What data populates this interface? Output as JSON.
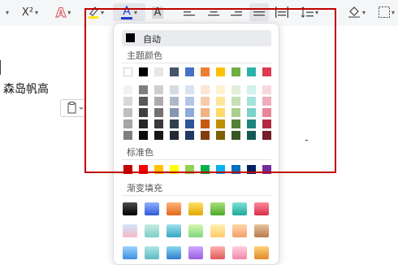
{
  "toolbar": {
    "superscript": "X²",
    "text_effect": "A",
    "font_color": "A",
    "char_shading": "A",
    "font_color_accent": "#1f3ccf",
    "highlight_accent": "#ffe600"
  },
  "document": {
    "text": "森岛帆高"
  },
  "color_panel": {
    "auto_label": "自动",
    "auto_color": "#000000",
    "theme_title": "主题颜色",
    "standard_title": "标准色",
    "gradient_title": "渐变填充",
    "theme_top": [
      "#ffffff",
      "#000000",
      "#e7e6e6",
      "#44546a",
      "#4472c4",
      "#ed7d31",
      "#ffc000",
      "#70ad47",
      "#2bb2a8",
      "#dd3b52"
    ],
    "theme_tints": [
      [
        "#f2f2f2",
        "#7f7f7f",
        "#d0cece",
        "#d6dce4",
        "#d9e2f3",
        "#fbe5d5",
        "#fff2cc",
        "#e2efd9",
        "#d2f0ec",
        "#f8d7dd"
      ],
      [
        "#d8d8d8",
        "#595959",
        "#aeabab",
        "#adb9ca",
        "#b4c6e7",
        "#f7caac",
        "#fee599",
        "#c5e0b3",
        "#a6e2da",
        "#f0aebb"
      ],
      [
        "#bfbfbf",
        "#3f3f3f",
        "#757070",
        "#8496b0",
        "#8eaadb",
        "#f4b083",
        "#ffd966",
        "#a8d08d",
        "#79d3c7",
        "#e98699"
      ],
      [
        "#a5a5a5",
        "#262626",
        "#3a3838",
        "#323f4f",
        "#2f5496",
        "#c55a11",
        "#bf8f00",
        "#538135",
        "#1e857d",
        "#b22a3f"
      ],
      [
        "#7f7f7f",
        "#0c0c0c",
        "#171616",
        "#222a35",
        "#1f3864",
        "#833c0b",
        "#7f6000",
        "#385623",
        "#145953",
        "#761c2a"
      ]
    ],
    "standard": [
      "#c00000",
      "#ff0000",
      "#ffc000",
      "#ffff00",
      "#92d050",
      "#00b050",
      "#00b0f0",
      "#0070c0",
      "#002060",
      "#7030a0"
    ],
    "gradients": [
      [
        "#4d4d4d",
        "#000000"
      ],
      [
        "#8fb1ff",
        "#2f5bd3"
      ],
      [
        "#ffb37a",
        "#e06a1c"
      ],
      [
        "#ffe06a",
        "#e0a800"
      ],
      [
        "#a8e07a",
        "#4fa82c"
      ],
      [
        "#7fe0d6",
        "#1fa89a"
      ],
      [
        "#ff8a9a",
        "#d43048"
      ],
      [
        "#cfe6ff",
        "#f7b8c8"
      ],
      [
        "#c8ece6",
        "#7ccfc4"
      ],
      [
        "#9ee0ec",
        "#3aa6c4"
      ],
      [
        "#d6f7b0",
        "#7fd67f"
      ],
      [
        "#fff2b0",
        "#ffc96b"
      ],
      [
        "#ffd6a8",
        "#f4a06a"
      ],
      [
        "#e8c4a0",
        "#b87a4a"
      ],
      [
        "#9fd4ff",
        "#3c8fe0"
      ],
      [
        "#aee8e0",
        "#5fb8c8"
      ],
      [
        "#8ad8f0",
        "#2e7fcc"
      ],
      [
        "#d0a8ff",
        "#9a5fe0"
      ],
      [
        "#ffb0b0",
        "#e05a5a"
      ],
      [
        "#ffd0e0",
        "#f088a8"
      ],
      [
        "#ffd27a",
        "#e08a2a"
      ]
    ]
  }
}
